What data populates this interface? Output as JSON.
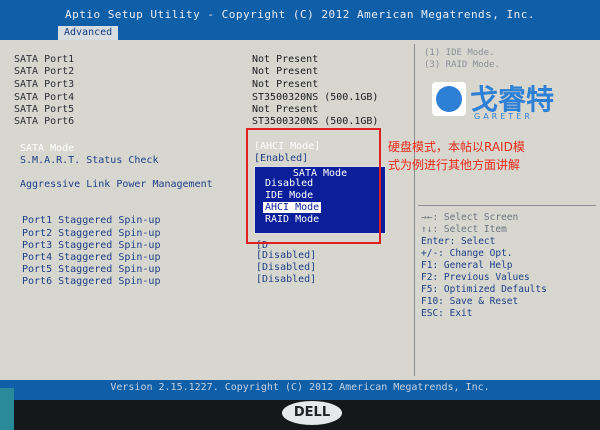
{
  "header": {
    "title": "Aptio Setup Utility - Copyright (C) 2012 American Megatrends, Inc."
  },
  "tabs": [
    {
      "label": "Advanced"
    }
  ],
  "ports": [
    {
      "label": "SATA Port1",
      "value": "Not Present"
    },
    {
      "label": "SATA Port2",
      "value": "Not Present"
    },
    {
      "label": "SATA Port3",
      "value": "Not Present"
    },
    {
      "label": "SATA Port4",
      "value": "ST3500320NS   (500.1GB)"
    },
    {
      "label": "SATA Port5",
      "value": "Not Present"
    },
    {
      "label": "SATA Port6",
      "value": "ST3500320NS   (500.1GB)"
    }
  ],
  "settings": {
    "sata_mode": {
      "label": "SATA Mode",
      "value": "[AHCI Mode]"
    },
    "smart": {
      "label": "S.M.A.R.T. Status Check",
      "value": "[Enabled]"
    },
    "alpm": {
      "label": "Aggressive Link Power Management"
    }
  },
  "staggered": [
    {
      "label": "Port1  Staggered Spin-up",
      "value": ""
    },
    {
      "label": "Port2  Staggered Spin-up",
      "value": ""
    },
    {
      "label": "Port3  Staggered Spin-up",
      "value": "[D"
    },
    {
      "label": "Port4  Staggered Spin-up",
      "value": "[Disabled]"
    },
    {
      "label": "Port5  Staggered Spin-up",
      "value": "[Disabled]"
    },
    {
      "label": "Port6  Staggered Spin-up",
      "value": "[Disabled]"
    }
  ],
  "popup": {
    "title": "SATA Mode",
    "options": [
      "Disabled",
      "IDE Mode",
      "AHCI Mode",
      "RAID Mode"
    ],
    "selected": "AHCI Mode"
  },
  "help_top": [
    "(1) IDE Mode.",
    "(3) RAID Mode."
  ],
  "help_keys": [
    "→←: Select Screen",
    "↑↓: Select Item",
    "Enter: Select",
    "+/-: Change Opt.",
    "F1: General Help",
    "F2: Previous Values",
    "F5: Optimized Defaults",
    "F10: Save & Reset",
    "ESC: Exit"
  ],
  "annotation": {
    "line1": "硬盘模式，本帖以RAID模",
    "line2": "式为例进行其他方面讲解"
  },
  "watermark": {
    "text": "戈睿特",
    "sub": "GAREТER"
  },
  "footer": {
    "text": "Version 2.15.1227. Copyright (C) 2012 American Megatrends, Inc."
  },
  "monitor": {
    "brand": "DELL"
  }
}
